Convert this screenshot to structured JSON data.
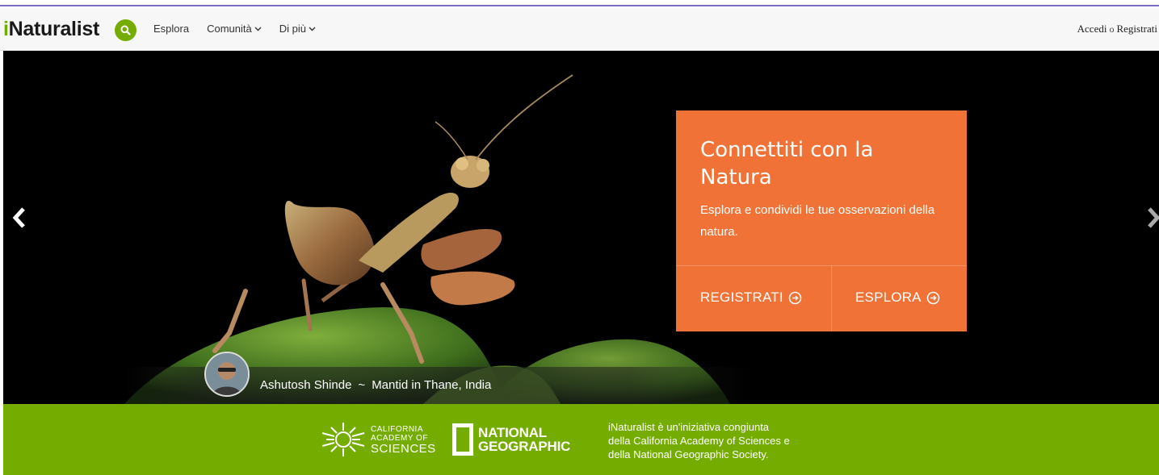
{
  "header": {
    "logo_text": "Naturalist",
    "logo_prefix": "i",
    "search_icon": "search-icon",
    "nav": [
      {
        "label": "Esplora",
        "dropdown": false
      },
      {
        "label": "Comunità",
        "dropdown": true
      },
      {
        "label": "Di più",
        "dropdown": true
      }
    ],
    "login_label": "Accedi",
    "separator": "o",
    "signup_label": "Registrati"
  },
  "hero": {
    "card": {
      "title": "Connettiti con la Natura",
      "subtitle": "Esplora e condividi le tue osservazioni della natura.",
      "signup_cta": "REGISTRATI",
      "explore_cta": "ESPLORA"
    },
    "credit": {
      "photographer": "Ashutosh Shinde",
      "separator": "~",
      "caption": "Mantid in Thane, India"
    }
  },
  "footer": {
    "cas_line1": "CALIFORNIA",
    "cas_line2": "ACADEMY OF",
    "cas_line3": "SCIENCES",
    "ng_line1": "NATIONAL",
    "ng_line2": "GEOGRAPHIC",
    "text_line1": "iNaturalist è un'iniziativa congiunta",
    "text_line2": "della California Academy of Sciences e",
    "text_line3": "della National Geographic Society."
  },
  "colors": {
    "brand_green": "#74ac00",
    "card_orange": "#f07236",
    "header_bg": "#f7f7f7"
  }
}
